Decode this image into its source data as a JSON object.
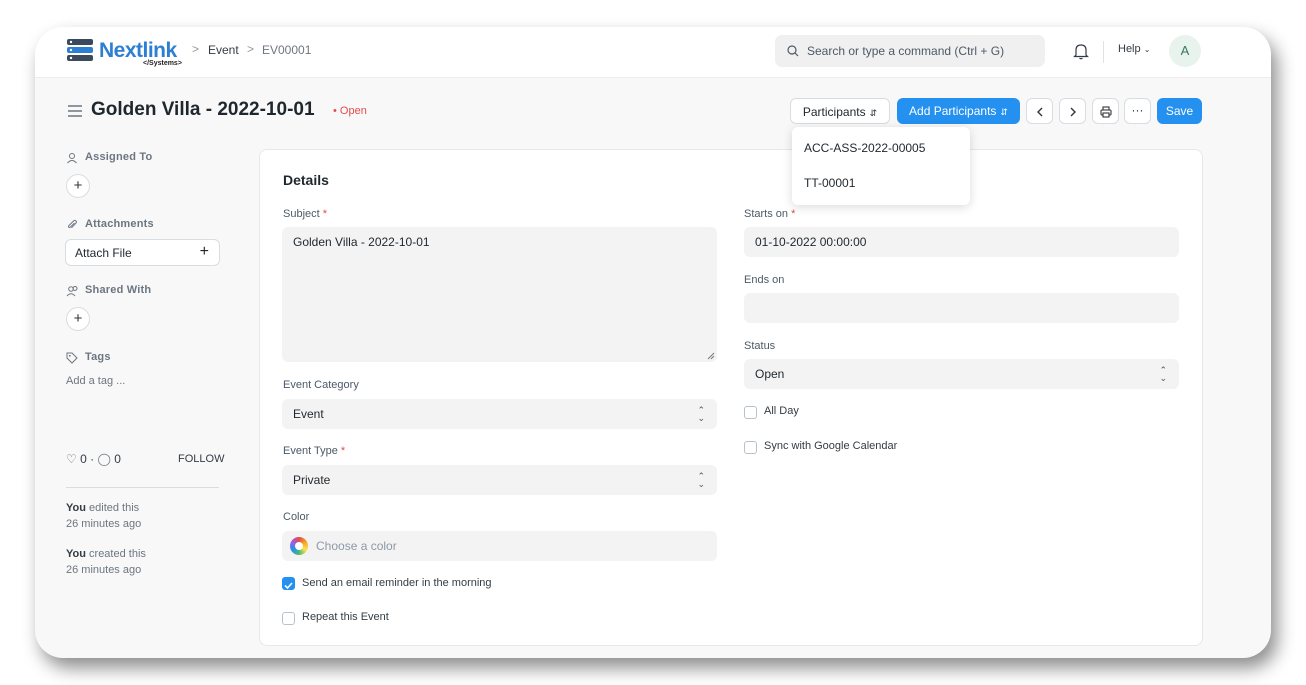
{
  "navbar": {
    "logo_text": "Nextlink",
    "logo_sub": "</Systems>",
    "breadcrumbs": [
      "Event",
      "EV00001"
    ],
    "search_placeholder": "Search or type a command (Ctrl + G)",
    "help_label": "Help",
    "avatar_initial": "A"
  },
  "header": {
    "title": "Golden Villa - 2022-10-01",
    "status": "Open",
    "participants_label": "Participants",
    "add_participants_label": "Add Participants",
    "save_label": "Save",
    "more_label": "···"
  },
  "participants_dropdown": [
    "ACC-ASS-2022-00005",
    "TT-00001"
  ],
  "sidebar": {
    "assigned_to_label": "Assigned To",
    "attachments_label": "Attachments",
    "attach_file_label": "Attach File",
    "shared_with_label": "Shared With",
    "tags_label": "Tags",
    "add_tag_placeholder": "Add a tag ...",
    "likes_count": "0",
    "comments_count": "0",
    "follow_label": "FOLLOW",
    "activity": [
      {
        "who": "You",
        "action": "edited this",
        "when": "26 minutes ago"
      },
      {
        "who": "You",
        "action": "created this",
        "when": "26 minutes ago"
      }
    ]
  },
  "details": {
    "section_title": "Details",
    "subject_label": "Subject",
    "subject_value": "Golden Villa - 2022-10-01",
    "event_category_label": "Event Category",
    "event_category_value": "Event",
    "event_type_label": "Event Type",
    "event_type_value": "Private",
    "color_label": "Color",
    "color_placeholder": "Choose a color",
    "send_reminder_label": "Send an email reminder in the morning",
    "send_reminder_checked": true,
    "repeat_label": "Repeat this Event",
    "repeat_checked": false,
    "starts_on_label": "Starts on",
    "starts_on_value": "01-10-2022 00:00:00",
    "ends_on_label": "Ends on",
    "ends_on_value": "",
    "status_label": "Status",
    "status_value": "Open",
    "all_day_label": "All Day",
    "all_day_checked": false,
    "sync_google_label": "Sync with Google Calendar",
    "sync_google_checked": false,
    "required_mark": "*"
  },
  "colors": {
    "primary": "#2490ef",
    "status_open": "#e24c4c",
    "logo_blue": "#2c7fd2"
  }
}
